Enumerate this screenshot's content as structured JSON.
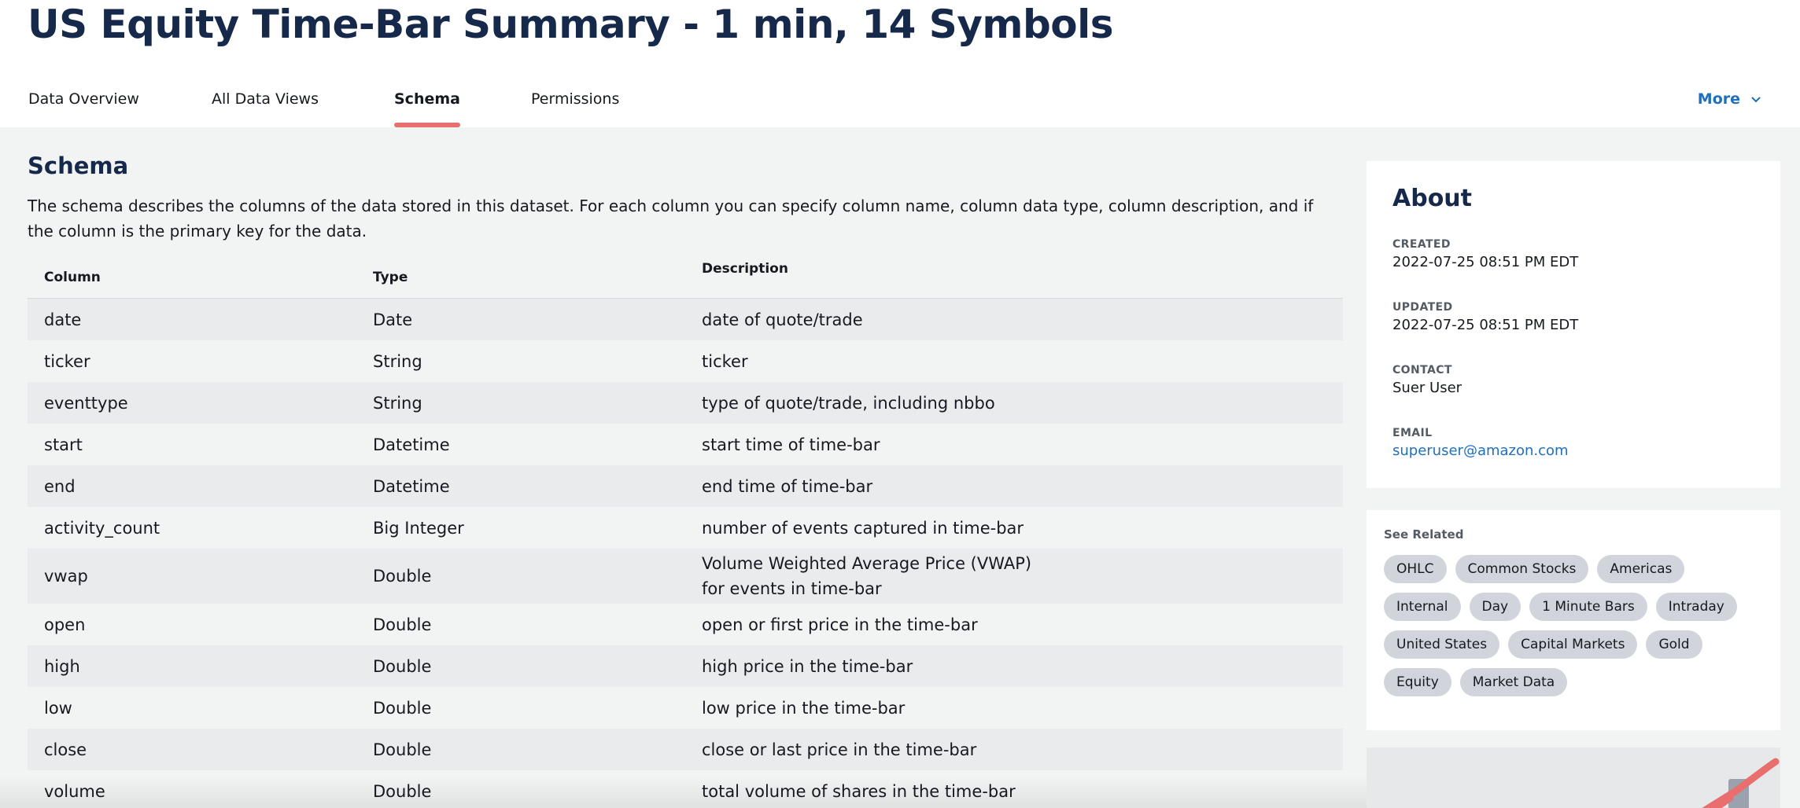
{
  "page": {
    "title": "US Equity Time-Bar Summary - 1 min, 14 Symbols"
  },
  "tabs": [
    {
      "label": "Data Overview",
      "active": false
    },
    {
      "label": "All Data Views",
      "active": false
    },
    {
      "label": "Schema",
      "active": true
    },
    {
      "label": "Permissions",
      "active": false
    }
  ],
  "more": {
    "label": "More",
    "icon": "chevron-down-icon"
  },
  "schema": {
    "title": "Schema",
    "description": "The schema describes the columns of the data stored in this dataset. For each column you can specify column name, column data type, column description, and if the column is the primary key for the data.",
    "headers": [
      "Column",
      "Type",
      "Description"
    ],
    "rows": [
      {
        "column": "date",
        "type": "Date",
        "description": "date of quote/trade"
      },
      {
        "column": "ticker",
        "type": "String",
        "description": "ticker"
      },
      {
        "column": "eventtype",
        "type": "String",
        "description": "type of quote/trade, including nbbo"
      },
      {
        "column": "start",
        "type": "Datetime",
        "description": "start time of time-bar"
      },
      {
        "column": "end",
        "type": "Datetime",
        "description": "end time of time-bar"
      },
      {
        "column": "activity_count",
        "type": "Big Integer",
        "description": "number of events captured in time-bar"
      },
      {
        "column": "vwap",
        "type": "Double",
        "description": "Volume Weighted Average Price (VWAP) for events in time-bar"
      },
      {
        "column": "open",
        "type": "Double",
        "description": "open or first price in the time-bar"
      },
      {
        "column": "high",
        "type": "Double",
        "description": "high price in the time-bar"
      },
      {
        "column": "low",
        "type": "Double",
        "description": "low price in the time-bar"
      },
      {
        "column": "close",
        "type": "Double",
        "description": "close or last price in the time-bar"
      },
      {
        "column": "volume",
        "type": "Double",
        "description": "total volume of shares in the time-bar"
      }
    ]
  },
  "about": {
    "title": "About",
    "created_label": "CREATED",
    "created_value": "2022-07-25 08:51 PM EDT",
    "updated_label": "UPDATED",
    "updated_value": "2022-07-25 08:51 PM EDT",
    "contact_label": "CONTACT",
    "contact_value": "Suer User",
    "email_label": "EMAIL",
    "email_value": "superuser@amazon.com"
  },
  "related": {
    "label": "See Related",
    "chips": [
      "OHLC",
      "Common Stocks",
      "Americas",
      "Internal",
      "Day",
      "1 Minute Bars",
      "Intraday",
      "United States",
      "Capital Markets",
      "Gold",
      "Equity",
      "Market Data"
    ]
  },
  "colors": {
    "title": "#16294a",
    "accent": "#e96e6e",
    "link": "#1f6fbf",
    "chip": "#d1d5db"
  }
}
